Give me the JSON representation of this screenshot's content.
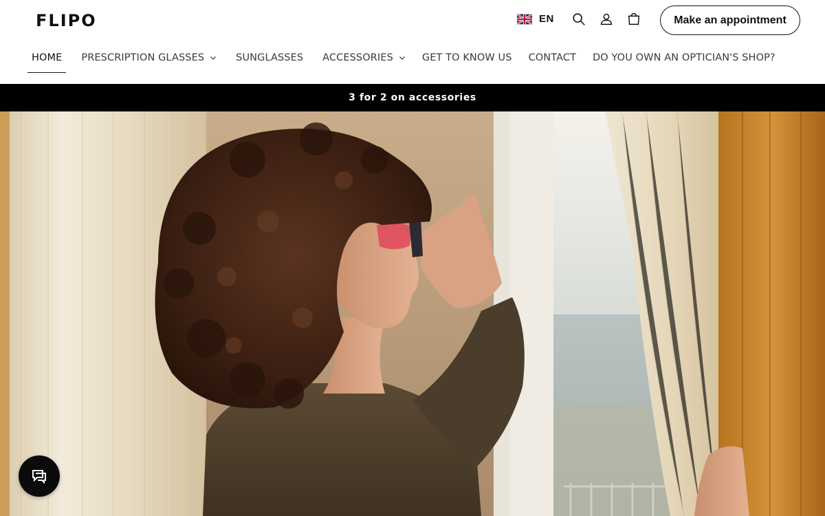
{
  "brand": {
    "logo_text": "FLIPO"
  },
  "header": {
    "language": {
      "code": "EN",
      "flag_icon": "uk-flag-icon"
    },
    "icons": [
      "search-icon",
      "account-icon",
      "cart-icon"
    ],
    "appointment_label": "Make an appointment"
  },
  "nav": {
    "items": [
      {
        "label": "HOME",
        "active": true,
        "dropdown": false
      },
      {
        "label": "PRESCRIPTION GLASSES",
        "active": false,
        "dropdown": true
      },
      {
        "label": "SUNGLASSES",
        "active": false,
        "dropdown": false
      },
      {
        "label": "ACCESSORIES",
        "active": false,
        "dropdown": true
      },
      {
        "label": "GET TO KNOW US",
        "active": false,
        "dropdown": false
      },
      {
        "label": "CONTACT",
        "active": false,
        "dropdown": false
      },
      {
        "label": "DO YOU OWN AN OPTICIAN'S SHOP?",
        "active": false,
        "dropdown": false
      }
    ]
  },
  "announcement": {
    "text": "3 for 2 on accessories"
  },
  "hero": {
    "image": "woman-with-sunglasses-by-window"
  },
  "chat": {
    "icon": "chat-icon"
  },
  "colors": {
    "text": "#111111",
    "announcement_bg": "#000000",
    "announcement_text": "#ffffff"
  }
}
